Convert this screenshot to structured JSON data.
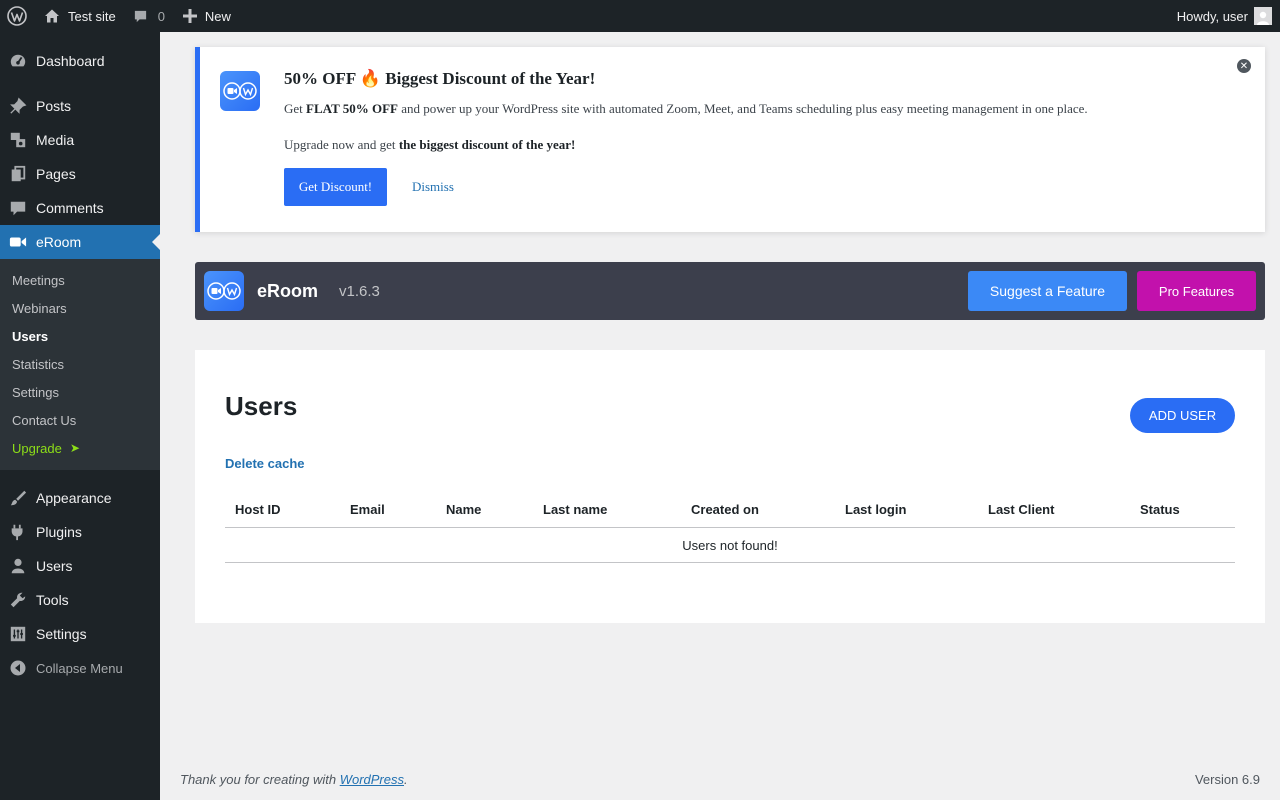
{
  "admin_bar": {
    "site_name": "Test site",
    "comments_count": "0",
    "new_label": "New",
    "greeting": "Howdy, user"
  },
  "sidebar": {
    "dashboard": "Dashboard",
    "posts": "Posts",
    "media": "Media",
    "pages": "Pages",
    "comments": "Comments",
    "eroom": "eRoom",
    "submenu": [
      "Meetings",
      "Webinars",
      "Users",
      "Statistics",
      "Settings",
      "Contact Us",
      "Upgrade"
    ],
    "upgrade_arrow": "➤",
    "appearance": "Appearance",
    "plugins": "Plugins",
    "users": "Users",
    "tools": "Tools",
    "settings": "Settings",
    "collapse": "Collapse Menu"
  },
  "notice": {
    "title": "50% OFF 🔥 Biggest Discount of the Year!",
    "line1_prefix": "Get ",
    "line1_bold": "FLAT 50% OFF",
    "line1_suffix": " and power up your WordPress site with automated Zoom, Meet, and Teams scheduling plus easy meeting management in one place.",
    "line2_prefix": "Upgrade now and get ",
    "line2_bold": "the biggest discount of the year!",
    "discount_button": "Get Discount!",
    "dismiss_button": "Dismiss",
    "accent_color": "#2a6df4"
  },
  "plugin_header": {
    "name": "eRoom",
    "version": "v1.6.3",
    "suggest_button": "Suggest a Feature",
    "pro_button": "Pro Features",
    "pro_color": "#c211ac"
  },
  "users_page": {
    "title": "Users",
    "add_button": "ADD USER",
    "delete_cache": "Delete cache",
    "columns": [
      "Host ID",
      "Email",
      "Name",
      "Last name",
      "Created on",
      "Last login",
      "Last Client",
      "Status"
    ],
    "empty_message": "Users not found!"
  },
  "footer": {
    "thanks_prefix": "Thank you for creating with ",
    "thanks_link": "WordPress",
    "thanks_suffix": ".",
    "version": "Version 6.9"
  }
}
